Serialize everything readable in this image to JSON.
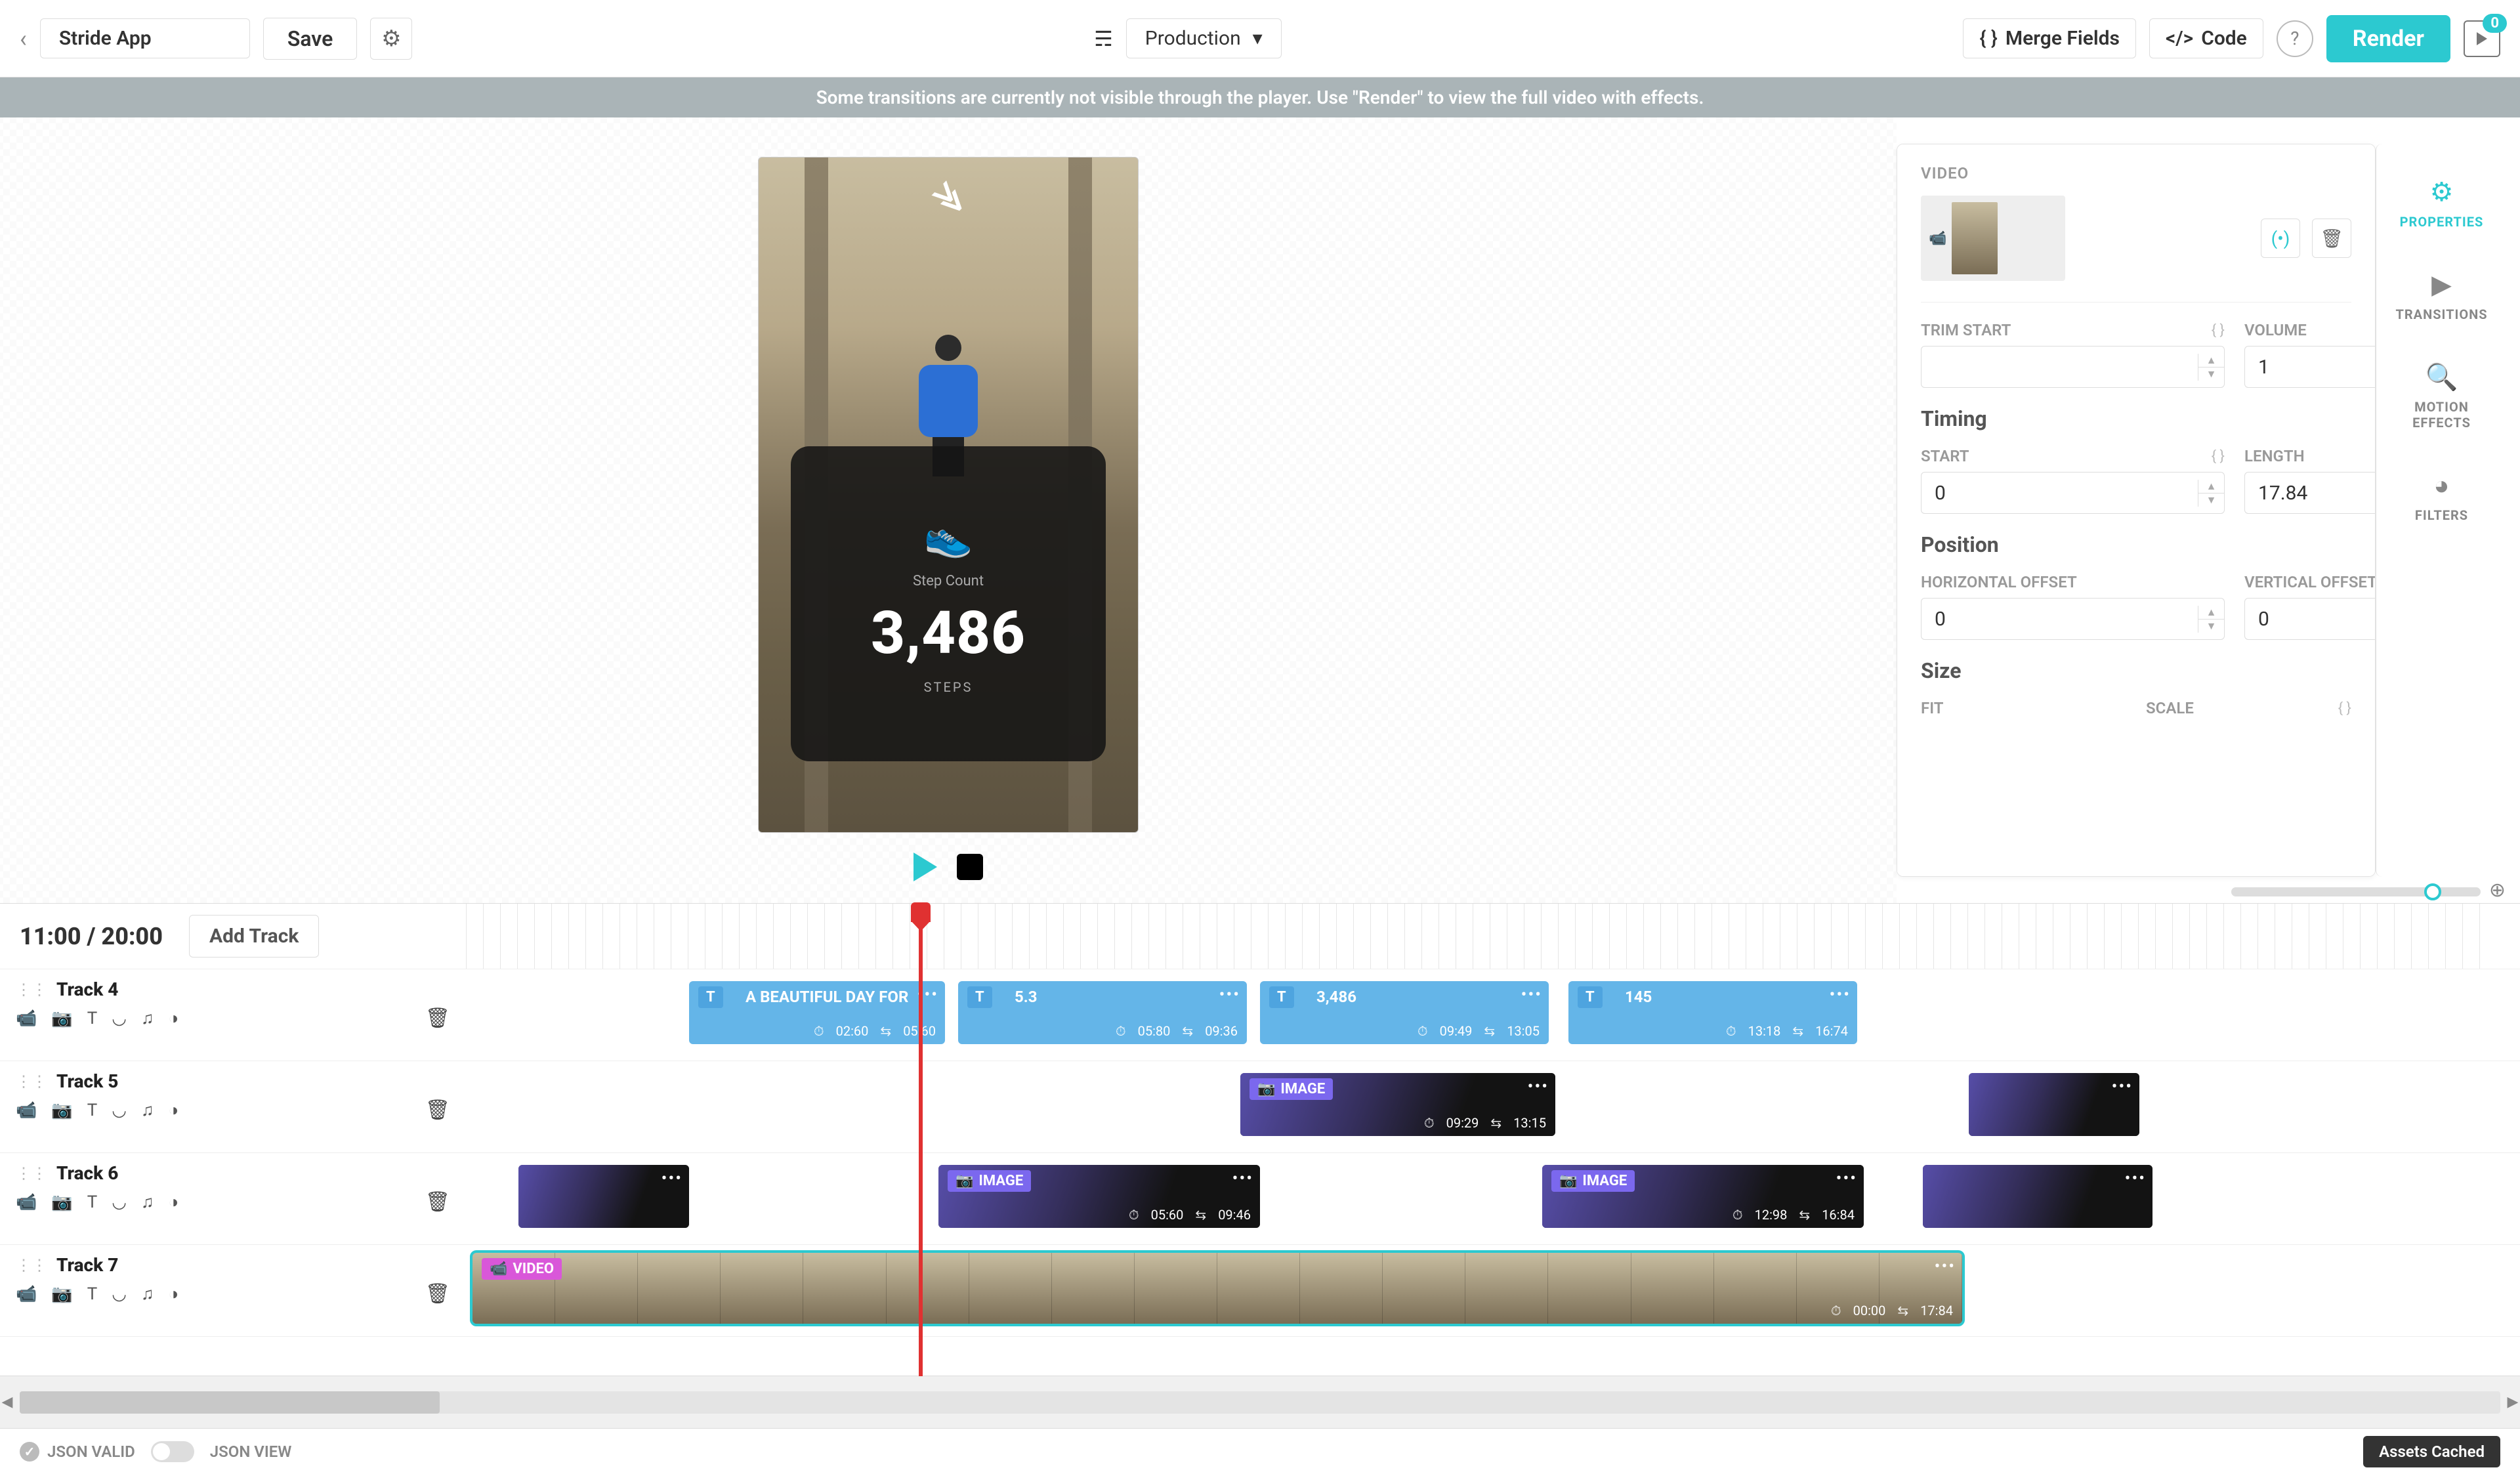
{
  "header": {
    "app_name": "Stride App",
    "save": "Save",
    "environment": "Production",
    "merge_fields": "Merge Fields",
    "code": "Code",
    "render": "Render",
    "queue_count": "0"
  },
  "banner": "Some transitions are currently not visible through the player. Use \"Render\" to view the full video with effects.",
  "preview": {
    "card_label": "Step Count",
    "card_value": "3,486",
    "card_unit": "STEPS"
  },
  "properties": {
    "section_video": "VIDEO",
    "trim_start": "TRIM START",
    "trim_start_value": "",
    "volume": "VOLUME",
    "volume_value": "1",
    "timing_heading": "Timing",
    "start": "START",
    "start_value": "0",
    "length": "LENGTH",
    "length_value": "17.84",
    "position_heading": "Position",
    "horiz_offset": "HORIZONTAL OFFSET",
    "horiz_offset_value": "0",
    "vert_offset": "VERTICAL OFFSET",
    "vert_offset_value": "0",
    "size_heading": "Size",
    "fit": "FIT",
    "scale": "SCALE"
  },
  "side_tabs": {
    "properties": "PROPERTIES",
    "transitions": "TRANSITIONS",
    "motion_effects": "MOTION\nEFFECTS",
    "filters": "FILTERS"
  },
  "timeline": {
    "time_display": "11:00 / 20:00",
    "add_track": "Add Track",
    "track4": "Track 4",
    "track5": "Track 5",
    "track6": "Track 6",
    "track7": "Track 7",
    "clip_badge_text": "T",
    "clip_badge_image": "IMAGE",
    "clip_badge_video": "VIDEO",
    "t4c1": {
      "title": "A BEAUTIFUL DAY FOR",
      "t1": "02:60",
      "t2": "05:60"
    },
    "t4c2": {
      "title": "5.3",
      "t1": "05:80",
      "t2": "09:36"
    },
    "t4c3": {
      "title": "3,486",
      "t1": "09:49",
      "t2": "13:05"
    },
    "t4c4": {
      "title": "145",
      "t1": "13:18",
      "t2": "16:74"
    },
    "t5c1": {
      "t1": "09:29",
      "t2": "13:15"
    },
    "t6c2": {
      "t1": "05:60",
      "t2": "09:46"
    },
    "t6c3": {
      "t1": "12:98",
      "t2": "16:84"
    },
    "t7c1": {
      "t1": "00:00",
      "t2": "17:84"
    }
  },
  "status": {
    "json_valid": "JSON VALID",
    "json_view": "JSON VIEW",
    "assets_cached": "Assets Cached"
  }
}
